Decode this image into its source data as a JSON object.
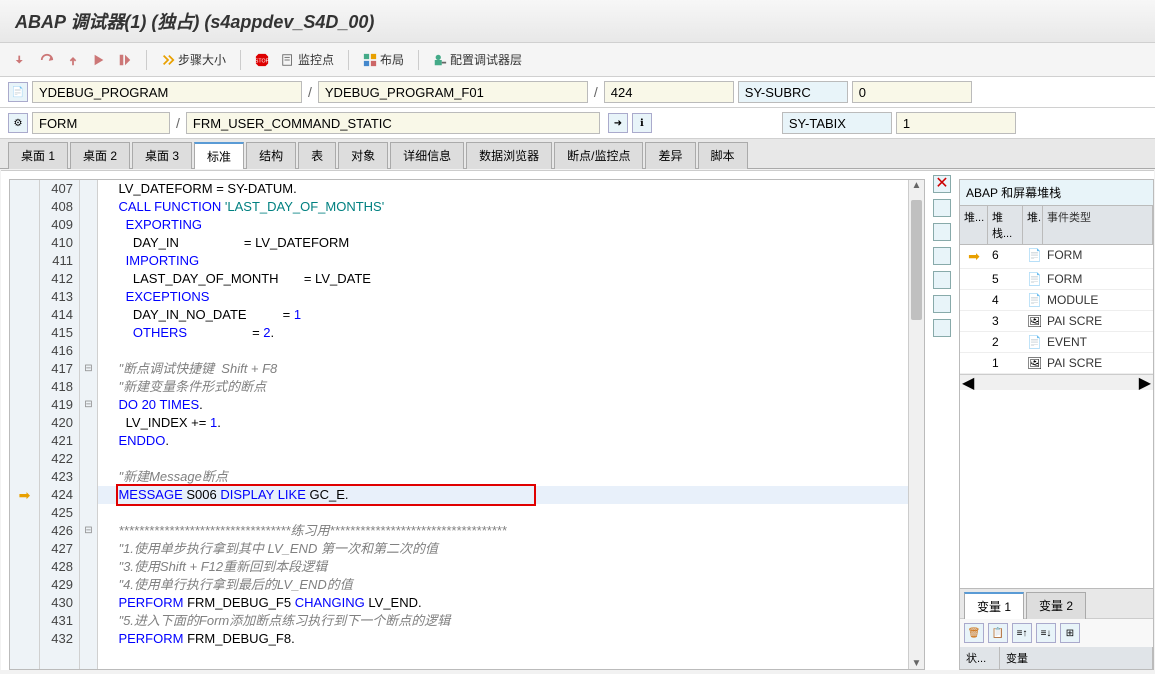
{
  "title": "ABAP 调试器(1) (独占) (s4appdev_S4D_00)",
  "toolbar": {
    "step_size": "步骤大小",
    "monitor_point": "监控点",
    "layout": "布局",
    "config_debugger": "配置调试器层"
  },
  "info": {
    "program": "YDEBUG_PROGRAM",
    "include": "YDEBUG_PROGRAM_F01",
    "line": "424",
    "sy_subrc_label": "SY-SUBRC",
    "sy_subrc_val": "0",
    "block_type": "FORM",
    "block_name": "FRM_USER_COMMAND_STATIC",
    "sy_tabix_label": "SY-TABIX",
    "sy_tabix_val": "1"
  },
  "tabs": [
    "桌面 1",
    "桌面 2",
    "桌面 3",
    "标准",
    "结构",
    "表",
    "对象",
    "详细信息",
    "数据浏览器",
    "断点/监控点",
    "差异",
    "脚本"
  ],
  "active_tab": 3,
  "code": [
    {
      "n": 407,
      "html": "    LV_DATEFORM = SY-DATUM."
    },
    {
      "n": 408,
      "html": "    <span class='kw'>CALL FUNCTION</span> <span class='str'>'LAST_DAY_OF_MONTHS'</span>"
    },
    {
      "n": 409,
      "html": "      <span class='kw'>EXPORTING</span>"
    },
    {
      "n": 410,
      "html": "        DAY_IN                  = LV_DATEFORM"
    },
    {
      "n": 411,
      "html": "      <span class='kw'>IMPORTING</span>"
    },
    {
      "n": 412,
      "html": "        LAST_DAY_OF_MONTH       = LV_DATE"
    },
    {
      "n": 413,
      "html": "      <span class='kw'>EXCEPTIONS</span>"
    },
    {
      "n": 414,
      "html": "        DAY_IN_NO_DATE          = <span class='kw'>1</span>"
    },
    {
      "n": 415,
      "html": "        <span class='kw'>OTHERS</span>                  = <span class='kw'>2</span>."
    },
    {
      "n": 416,
      "html": ""
    },
    {
      "n": 417,
      "html": "    <span class='cmt'>\"断点调试快捷键  Shift + F8</span>",
      "fold": "⊟"
    },
    {
      "n": 418,
      "html": "    <span class='cmt'>\"新建变量条件形式的断点</span>"
    },
    {
      "n": 419,
      "html": "    <span class='kw'>DO</span> <span class='kw'>20</span> <span class='kw'>TIMES</span>.",
      "fold": "⊟"
    },
    {
      "n": 420,
      "html": "      LV_INDEX += <span class='kw'>1</span>."
    },
    {
      "n": 421,
      "html": "    <span class='kw'>ENDDO</span>."
    },
    {
      "n": 422,
      "html": ""
    },
    {
      "n": 423,
      "html": "    <span class='cmt'>\"新建Message断点</span>"
    },
    {
      "n": 424,
      "html": "    <span class='kw'>MESSAGE</span> S006 <span class='kw'>DISPLAY</span> <span class='kw'>LIKE</span> GC_E.",
      "cur": true,
      "arrow": true
    },
    {
      "n": 425,
      "html": ""
    },
    {
      "n": 426,
      "html": "    <span class='cmt'>**********************************练习用***********************************</span>",
      "fold": "⊟"
    },
    {
      "n": 427,
      "html": "    <span class='cmt'>\"1.使用单步执行拿到其中 LV_END 第一次和第二次的值</span>"
    },
    {
      "n": 428,
      "html": "    <span class='cmt'>\"3.使用Shift + F12重新回到本段逻辑</span>"
    },
    {
      "n": 429,
      "html": "    <span class='cmt'>\"4.使用单行执行拿到最后的LV_END的值</span>"
    },
    {
      "n": 430,
      "html": "    <span class='kw'>PERFORM</span> FRM_DEBUG_F5 <span class='kw'>CHANGING</span> LV_END."
    },
    {
      "n": 431,
      "html": "    <span class='cmt'>\"5.进入下面的Form添加断点练习执行到下一个断点的逻辑</span>"
    },
    {
      "n": 432,
      "html": "    <span class='kw'>PERFORM</span> FRM_DEBUG_F8."
    }
  ],
  "stack": {
    "title": "ABAP 和屏幕堆栈",
    "headers": [
      "堆...",
      "堆栈...",
      "堆.",
      "事件类型"
    ],
    "rows": [
      {
        "arrow": true,
        "depth": "6",
        "icon": "📄",
        "type": "FORM"
      },
      {
        "arrow": false,
        "depth": "5",
        "icon": "📄",
        "type": "FORM"
      },
      {
        "arrow": false,
        "depth": "4",
        "icon": "📄",
        "type": "MODULE"
      },
      {
        "arrow": false,
        "depth": "3",
        "icon": "🖼",
        "type": "PAI SCRE"
      },
      {
        "arrow": false,
        "depth": "2",
        "icon": "📄",
        "type": "EVENT"
      },
      {
        "arrow": false,
        "depth": "1",
        "icon": "🖼",
        "type": "PAI SCRE"
      }
    ]
  },
  "var_tabs": [
    "变量 1",
    "变量 2"
  ],
  "var_headers": [
    "状...",
    "变量"
  ]
}
